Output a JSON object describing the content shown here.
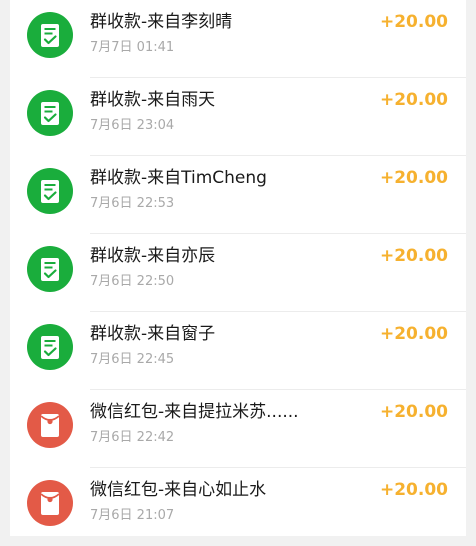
{
  "colors": {
    "group_icon_bg": "#1aad3c",
    "red_packet_icon_bg": "#e35a47",
    "amount": "#f6b12f"
  },
  "transactions": [
    {
      "icon": "group-receipt-icon",
      "title": "群收款-来自李刻晴",
      "time": "7月7日 01:41",
      "amount": "+20.00"
    },
    {
      "icon": "group-receipt-icon",
      "title": "群收款-来自雨天",
      "time": "7月6日 23:04",
      "amount": "+20.00"
    },
    {
      "icon": "group-receipt-icon",
      "title": "群收款-来自TimCheng",
      "time": "7月6日 22:53",
      "amount": "+20.00"
    },
    {
      "icon": "group-receipt-icon",
      "title": "群收款-来自亦辰",
      "time": "7月6日 22:50",
      "amount": "+20.00"
    },
    {
      "icon": "group-receipt-icon",
      "title": "群收款-来自窗子",
      "time": "7月6日 22:45",
      "amount": "+20.00"
    },
    {
      "icon": "red-packet-icon",
      "title": "微信红包-来自提拉米苏......",
      "time": "7月6日 22:42",
      "amount": "+20.00"
    },
    {
      "icon": "red-packet-icon",
      "title": "微信红包-来自心如止水",
      "time": "7月6日 21:07",
      "amount": "+20.00"
    }
  ]
}
